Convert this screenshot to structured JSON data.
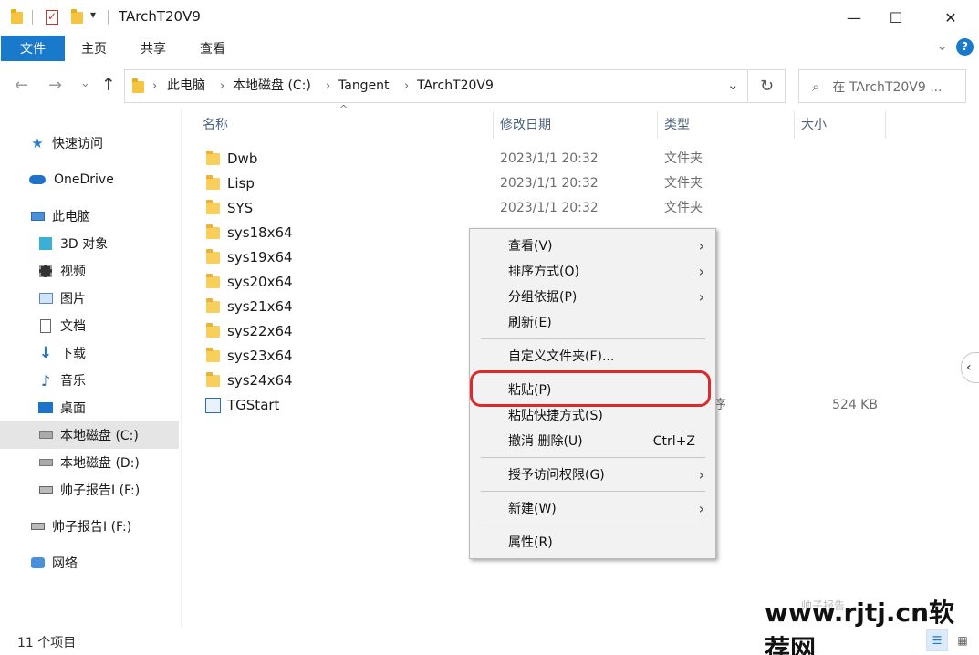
{
  "window": {
    "title": "TArchT20V9",
    "minimize": "—",
    "maximize": "☐",
    "close": "✕",
    "qa_dropdown": "▾"
  },
  "ribbon": {
    "tabs": [
      "文件",
      "主页",
      "共享",
      "查看"
    ],
    "collapse": "⌄",
    "help": "?"
  },
  "address": {
    "back": "←",
    "forward": "→",
    "recent": "⌄",
    "up": "↑",
    "crumbs": [
      "此电脑",
      "本地磁盘 (C:)",
      "Tangent",
      "TArchT20V9"
    ],
    "dropdown": "⌄",
    "refresh": "↻",
    "search_placeholder": "在 TArchT20V9 ..."
  },
  "nav": {
    "items": [
      {
        "label": "快速访问",
        "icon": "star-icon"
      },
      {
        "label": "OneDrive",
        "icon": "cloud-icon"
      },
      {
        "label": "此电脑",
        "icon": "computer-icon"
      },
      {
        "label": "3D 对象",
        "icon": "cube-icon"
      },
      {
        "label": "视频",
        "icon": "video-icon"
      },
      {
        "label": "图片",
        "icon": "picture-icon"
      },
      {
        "label": "文档",
        "icon": "document-icon"
      },
      {
        "label": "下载",
        "icon": "download-icon"
      },
      {
        "label": "音乐",
        "icon": "music-icon"
      },
      {
        "label": "桌面",
        "icon": "desktop-icon"
      },
      {
        "label": "本地磁盘 (C:)",
        "icon": "drive-icon"
      },
      {
        "label": "本地磁盘 (D:)",
        "icon": "drive-icon"
      },
      {
        "label": "帅子报告I (F:)",
        "icon": "usb-drive-icon"
      },
      {
        "label": "帅子报告I (F:)",
        "icon": "usb-drive-icon"
      },
      {
        "label": "网络",
        "icon": "network-icon"
      }
    ]
  },
  "columns": {
    "name": "名称",
    "date": "修改日期",
    "type": "类型",
    "size": "大小",
    "sort_indicator": "^"
  },
  "files": [
    {
      "name": "Dwb",
      "date": "2023/1/1 20:32",
      "type": "文件夹",
      "size": ""
    },
    {
      "name": "Lisp",
      "date": "2023/1/1 20:32",
      "type": "文件夹",
      "size": ""
    },
    {
      "name": "SYS",
      "date": "2023/1/1 20:32",
      "type": "文件夹",
      "size": ""
    },
    {
      "name": "sys18x64",
      "date": "",
      "type": "",
      "size": ""
    },
    {
      "name": "sys19x64",
      "date": "",
      "type": "",
      "size": ""
    },
    {
      "name": "sys20x64",
      "date": "",
      "type": "",
      "size": ""
    },
    {
      "name": "sys21x64",
      "date": "",
      "type": "",
      "size": ""
    },
    {
      "name": "sys22x64",
      "date": "",
      "type": "",
      "size": ""
    },
    {
      "name": "sys23x64",
      "date": "",
      "type": "",
      "size": ""
    },
    {
      "name": "sys24x64",
      "date": "",
      "type": "",
      "size": ""
    },
    {
      "name": "TGStart",
      "date": "",
      "type": "序",
      "size": "524 KB"
    }
  ],
  "context_menu": {
    "view": "查看(V)",
    "sort": "排序方式(O)",
    "group": "分组依据(P)",
    "refresh": "刷新(E)",
    "customize": "自定义文件夹(F)...",
    "paste": "粘贴(P)",
    "paste_shortcut": "粘贴快捷方式(S)",
    "undo": "撤消 删除(U)",
    "undo_shortcut": "Ctrl+Z",
    "grant_access": "授予访问权限(G)",
    "new": "新建(W)",
    "properties": "属性(R)",
    "submenu_arrow": "›"
  },
  "status": {
    "item_count": "11 个项目"
  },
  "watermark": "www.rjtj.cn软荐网",
  "watermark_sub": "帅子报告",
  "colors": {
    "accent": "#1979ca",
    "highlight_circle": "#d92b2b"
  }
}
